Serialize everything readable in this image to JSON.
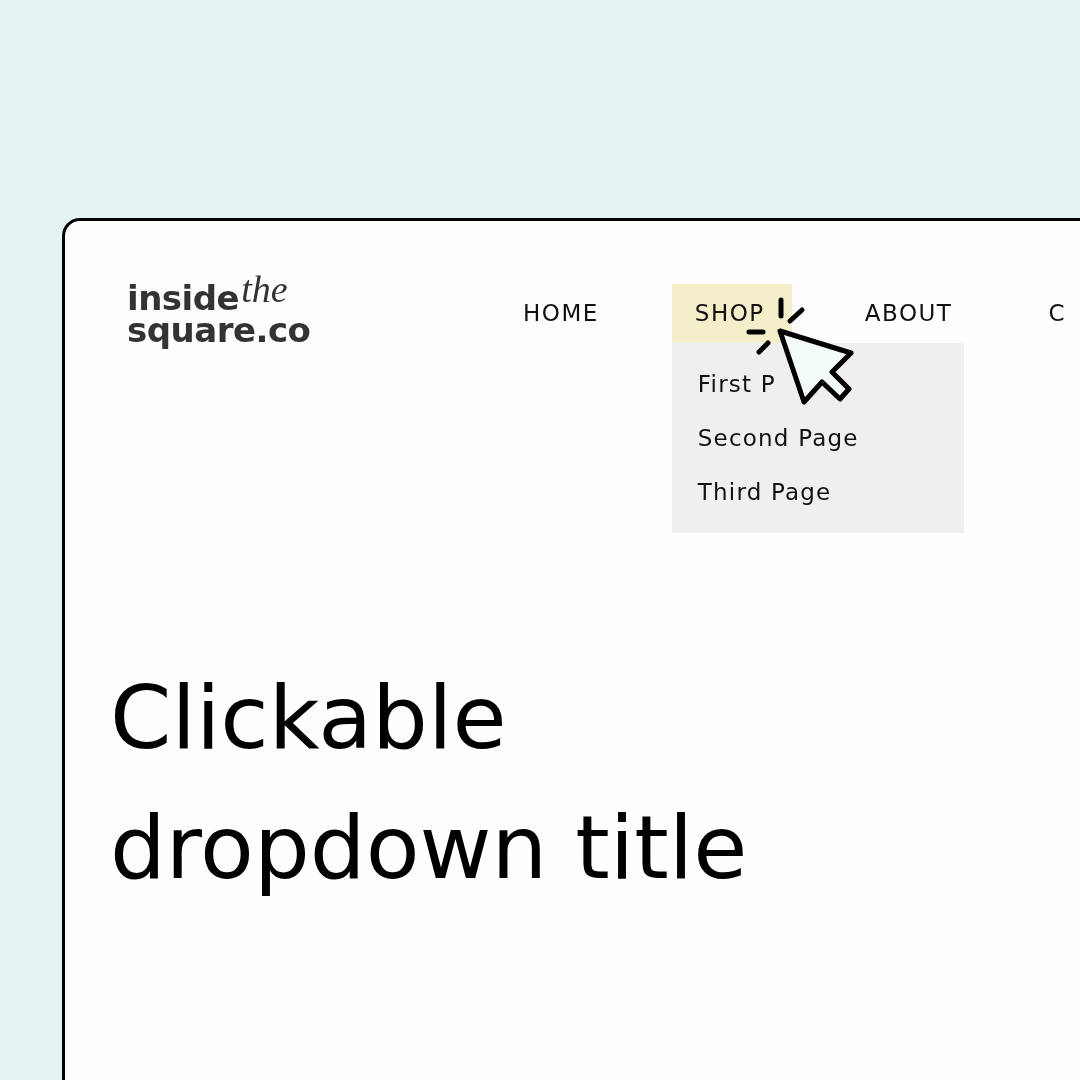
{
  "logo": {
    "top": "inside",
    "script": "the",
    "bottom": "square.co"
  },
  "nav": {
    "items": [
      {
        "label": "HOME",
        "selected": false
      },
      {
        "label": "SHOP",
        "selected": true,
        "submenu": [
          "First P",
          "Second Page",
          "Third Page"
        ]
      },
      {
        "label": "ABOUT",
        "selected": false
      },
      {
        "label": "C",
        "selected": false
      }
    ]
  },
  "heading": "Clickable dropdown title"
}
